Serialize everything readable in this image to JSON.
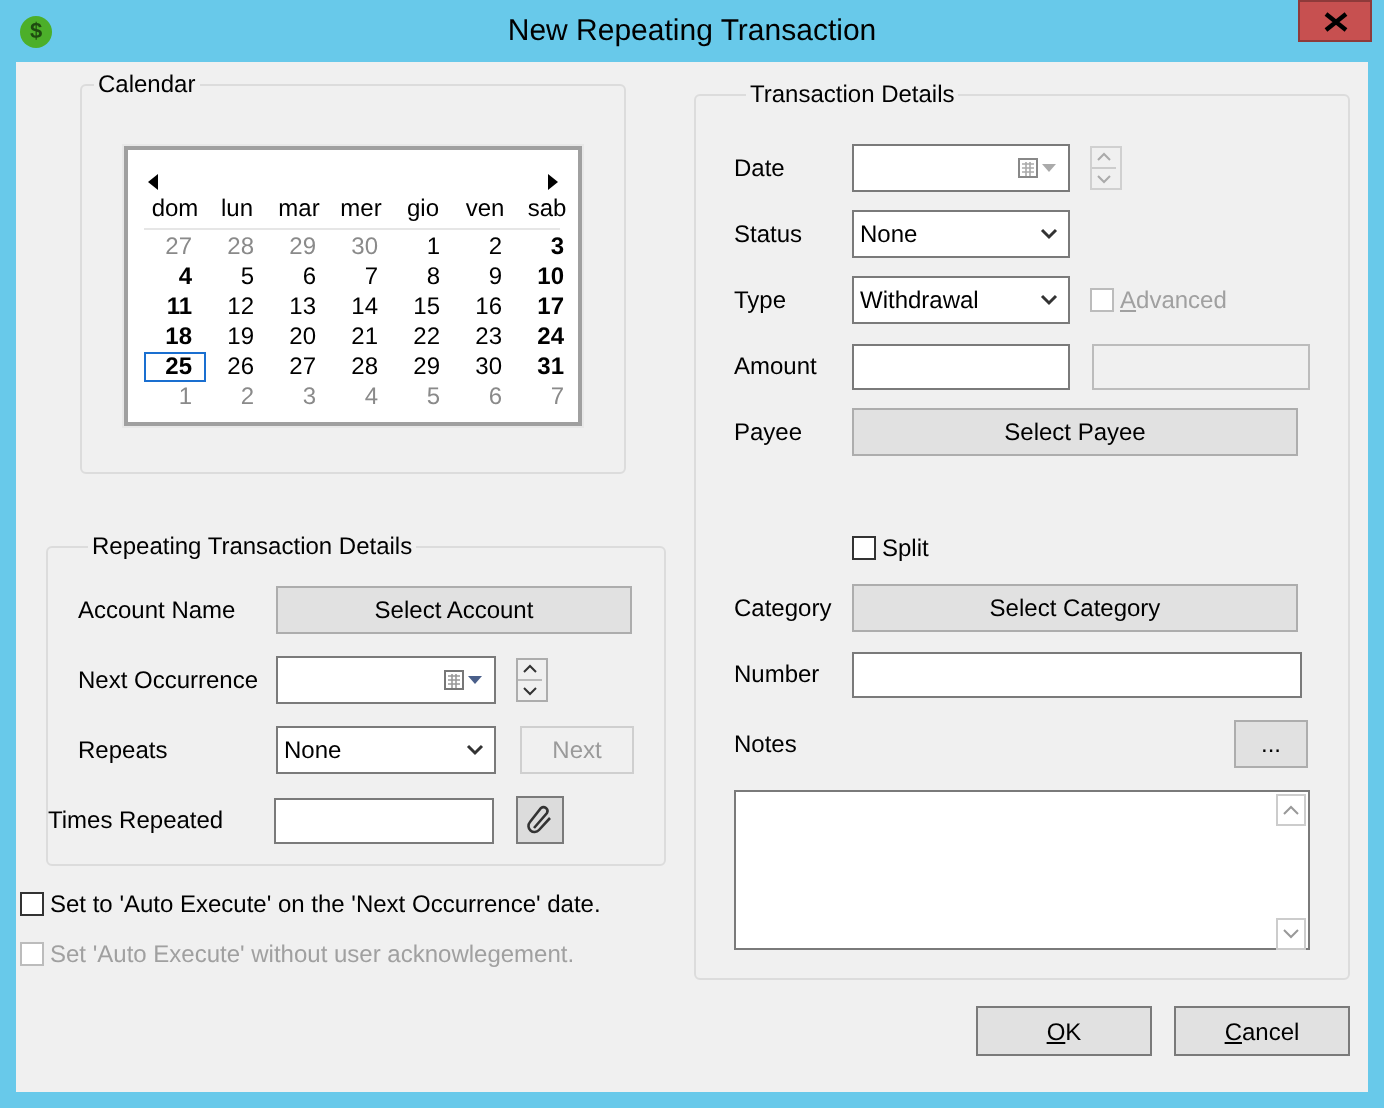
{
  "window": {
    "title": "New Repeating Transaction",
    "icon": "$"
  },
  "calendar": {
    "title": "Calendar",
    "weekdays": [
      "dom",
      "lun",
      "mar",
      "mer",
      "gio",
      "ven",
      "sab"
    ],
    "weeks": [
      [
        {
          "text": "27",
          "kind": "other",
          "selected": false
        },
        {
          "text": "28",
          "kind": "other",
          "selected": false
        },
        {
          "text": "29",
          "kind": "other",
          "selected": false
        },
        {
          "text": "30",
          "kind": "other",
          "selected": false
        },
        {
          "text": "1",
          "kind": "weekday",
          "selected": false
        },
        {
          "text": "2",
          "kind": "weekday",
          "selected": false
        },
        {
          "text": "3",
          "kind": "weekend",
          "selected": false
        }
      ],
      [
        {
          "text": "4",
          "kind": "weekend",
          "selected": false
        },
        {
          "text": "5",
          "kind": "weekday",
          "selected": false
        },
        {
          "text": "6",
          "kind": "weekday",
          "selected": false
        },
        {
          "text": "7",
          "kind": "weekday",
          "selected": false
        },
        {
          "text": "8",
          "kind": "weekday",
          "selected": false
        },
        {
          "text": "9",
          "kind": "weekday",
          "selected": false
        },
        {
          "text": "10",
          "kind": "weekend",
          "selected": false
        }
      ],
      [
        {
          "text": "11",
          "kind": "weekend",
          "selected": false
        },
        {
          "text": "12",
          "kind": "weekday",
          "selected": false
        },
        {
          "text": "13",
          "kind": "weekday",
          "selected": false
        },
        {
          "text": "14",
          "kind": "weekday",
          "selected": false
        },
        {
          "text": "15",
          "kind": "weekday",
          "selected": false
        },
        {
          "text": "16",
          "kind": "weekday",
          "selected": false
        },
        {
          "text": "17",
          "kind": "weekend",
          "selected": false
        }
      ],
      [
        {
          "text": "18",
          "kind": "weekend",
          "selected": false
        },
        {
          "text": "19",
          "kind": "weekday",
          "selected": false
        },
        {
          "text": "20",
          "kind": "weekday",
          "selected": false
        },
        {
          "text": "21",
          "kind": "weekday",
          "selected": false
        },
        {
          "text": "22",
          "kind": "weekday",
          "selected": false
        },
        {
          "text": "23",
          "kind": "weekday",
          "selected": false
        },
        {
          "text": "24",
          "kind": "weekend",
          "selected": false
        }
      ],
      [
        {
          "text": "25",
          "kind": "weekend",
          "selected": true
        },
        {
          "text": "26",
          "kind": "weekday",
          "selected": false
        },
        {
          "text": "27",
          "kind": "weekday",
          "selected": false
        },
        {
          "text": "28",
          "kind": "weekday",
          "selected": false
        },
        {
          "text": "29",
          "kind": "weekday",
          "selected": false
        },
        {
          "text": "30",
          "kind": "weekday",
          "selected": false
        },
        {
          "text": "31",
          "kind": "weekend",
          "selected": false
        }
      ],
      [
        {
          "text": "1",
          "kind": "other",
          "selected": false
        },
        {
          "text": "2",
          "kind": "other",
          "selected": false
        },
        {
          "text": "3",
          "kind": "other",
          "selected": false
        },
        {
          "text": "4",
          "kind": "other",
          "selected": false
        },
        {
          "text": "5",
          "kind": "other",
          "selected": false
        },
        {
          "text": "6",
          "kind": "other",
          "selected": false
        },
        {
          "text": "7",
          "kind": "other",
          "selected": false
        }
      ]
    ]
  },
  "repeating": {
    "title": "Repeating Transaction Details",
    "account": {
      "label": "Account Name",
      "button": "Select Account"
    },
    "next_occurrence": {
      "label": "Next Occurrence"
    },
    "repeats": {
      "label": "Repeats",
      "value": "None",
      "next_button": "Next",
      "next_disabled": true
    },
    "times": {
      "label": "Times Repeated"
    }
  },
  "options": [
    {
      "label": "Set to 'Auto Execute' on the 'Next Occurrence' date.",
      "checked": false,
      "disabled": false
    },
    {
      "label": "Set 'Auto Execute' without user acknowlegement.",
      "checked": false,
      "disabled": true
    }
  ],
  "details": {
    "title": "Transaction Details",
    "date": {
      "label": "Date",
      "spinner_disabled": true
    },
    "status": {
      "label": "Status",
      "value": "None"
    },
    "type": {
      "label": "Type",
      "value": "Withdrawal",
      "advanced": {
        "label": "Advanced",
        "checked": false,
        "disabled": true,
        "mnemonic": true
      }
    },
    "amount": {
      "label": "Amount",
      "second_disabled": true
    },
    "payee": {
      "label": "Payee",
      "button": "Select Payee"
    },
    "split": {
      "label": "Split",
      "checked": false
    },
    "category": {
      "label": "Category",
      "button": "Select Category"
    },
    "number": {
      "label": "Number"
    },
    "notes": {
      "label": "Notes",
      "button": "..."
    }
  },
  "buttons": [
    {
      "label": "OK",
      "mnemonic": true
    },
    {
      "label": "Cancel",
      "mnemonic": true
    }
  ]
}
